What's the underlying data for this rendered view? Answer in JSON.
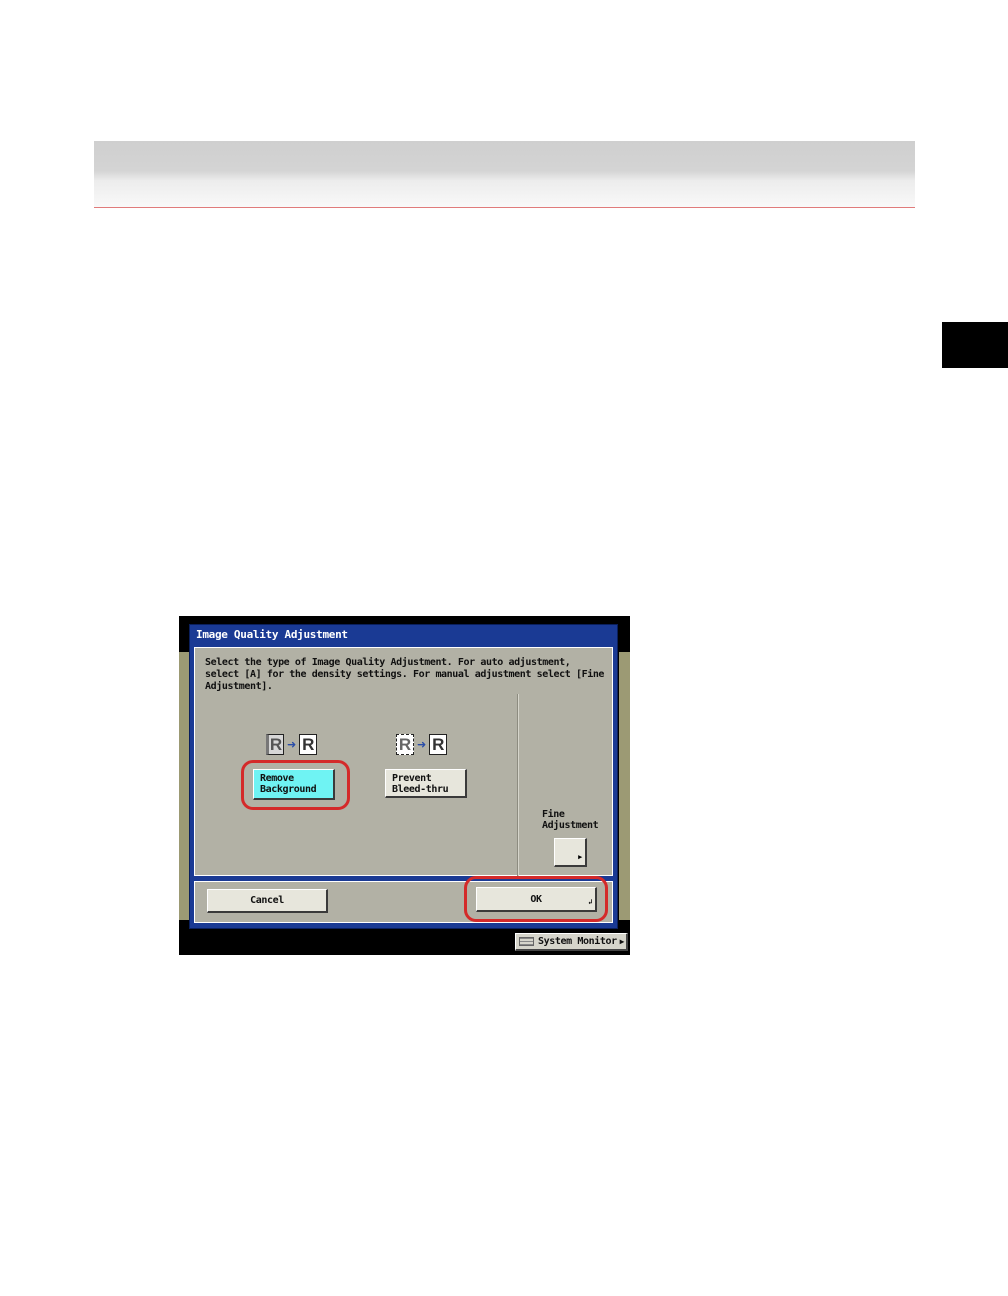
{
  "dialog": {
    "title": "Image Quality Adjustment",
    "instructions": "Select the type of Image Quality Adjustment. For auto adjustment, select [A] for the density settings. For manual adjustment select [Fine Adjustment].",
    "options": [
      {
        "label": "Remove\nBackground",
        "selected": true,
        "icon_left": "R",
        "icon_right": "R"
      },
      {
        "label": "Prevent\nBleed-thru",
        "selected": false,
        "icon_left": "R",
        "icon_right": "R"
      }
    ],
    "fine_adjustment_label": "Fine\nAdjustment",
    "cancel_label": "Cancel",
    "ok_label": "OK"
  },
  "status": {
    "system_monitor_label": "System Monitor"
  },
  "colors": {
    "dialog_frame": "#1a3a94",
    "panel_bg": "#b2b1a5",
    "selected_button": "#6ff3f3",
    "highlight_ring": "#d42a2a",
    "page_accent_rule": "#e07b7b"
  },
  "icons": {
    "arrow": "right-arrow-icon",
    "submenu": "submenu-arrow-icon",
    "system_monitor": "system-monitor-icon"
  }
}
